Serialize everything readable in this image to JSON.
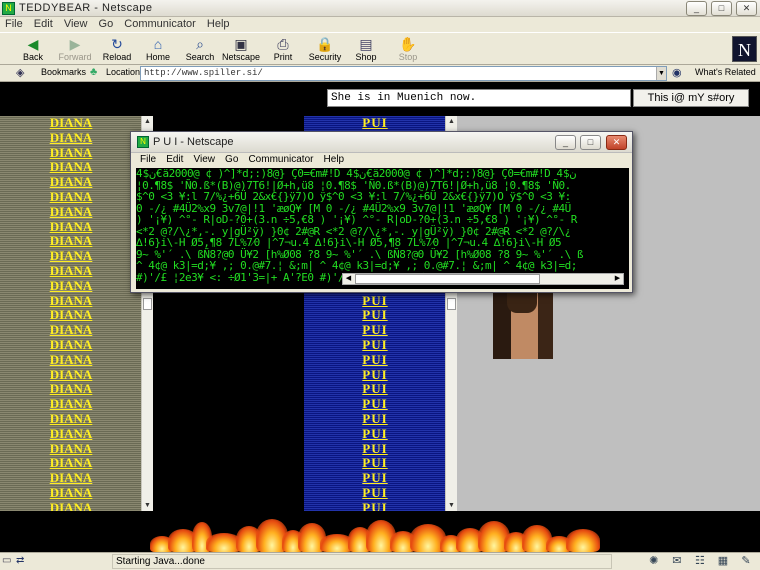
{
  "window": {
    "title": "TEDDYBEAR - Netscape",
    "min_label": "_",
    "max_label": "□",
    "close_label": "✕"
  },
  "menu": [
    "File",
    "Edit",
    "View",
    "Go",
    "Communicator",
    "Help"
  ],
  "toolbar": {
    "buttons": [
      {
        "label": "Back",
        "icon": "back-arrow-icon",
        "glyph": "◀"
      },
      {
        "label": "Forward",
        "icon": "forward-arrow-icon",
        "glyph": "▶"
      },
      {
        "label": "Reload",
        "icon": "reload-icon",
        "glyph": "↻"
      },
      {
        "label": "Home",
        "icon": "home-icon",
        "glyph": "⌂"
      },
      {
        "label": "Search",
        "icon": "search-icon",
        "glyph": "⌕"
      },
      {
        "label": "Netscape",
        "icon": "netscape-icon",
        "glyph": "▣"
      },
      {
        "label": "Print",
        "icon": "print-icon",
        "glyph": "⎙"
      },
      {
        "label": "Security",
        "icon": "lock-icon",
        "glyph": "🔒"
      },
      {
        "label": "Shop",
        "icon": "shop-icon",
        "glyph": "▤"
      },
      {
        "label": "Stop",
        "icon": "stop-icon",
        "glyph": "✋"
      }
    ],
    "logo": "N"
  },
  "location": {
    "bookmarks_label": "Bookmarks",
    "location_label": "Location:",
    "url": "http://www.spiller.si/",
    "whats_related_label": "What's Related"
  },
  "page": {
    "message_value": "She is in Muenich now.",
    "story_button": "This i@ mY s#ory",
    "left_frame_word": "DIANA",
    "left_frame_repeat": 27,
    "mid_frame_word": "PUI",
    "mid_frame_repeat": 27
  },
  "popup": {
    "title": "P U I - Netscape",
    "menu": [
      "File",
      "Edit",
      "View",
      "Go",
      "Communicator",
      "Help"
    ],
    "matrix_lines": [
      "ن$4€ä2000@ ¢ )^]*d;:)8@} Ç0=€m#!D ن$4€ä2000@ ¢ )^]*d;:)8@} Ç0=€m#!D ن$4",
      "¦0.¶8$ 'Ñ0.ß*(B)@)7T6!|Ø+h,ü8 ¦0.¶8$ 'Ñ0.ß*(B)@)7T6!|Ø+h,ü8 ¦0.¶8$ 'Ñ0.",
      "$^0 <3 ¥:l 7/%¿+6Ü 2&x€{}ÿ7)O ÿ$^0 <3 ¥:l 7/%¿+6Ü 2&x€{}ÿ7)O ÿ$^0 <3 ¥:",
      "0 -/¿ #4Ü2%x9 3v7@|!1 'æøQ¥ [M 0 -/¿ #4Ü2%x9 3v7@|!1 'æøQ¥ [M 0 -/¿ #4Ü",
      ") '¡¥) ^°- R|oD-?0+(3.n ÷5,€8 ) '¡¥) ^°- R|oD-?0+(3.n ÷5,€8 ) '¡¥) ^°- R",
      "<*2 @?/\\¿*,-. y|gÜ²ÿ) }0¢ 2#@R <*2 @?/\\¿*,-. y|gÜ²ÿ) }0¢ 2#@R <*2 @?/\\¿",
      "∆!6}i\\-H Ø5,¶8 7L%7⁄0 |^7¬u.4 ∆!6}i\\-H Ø5,¶8 7L%7⁄0 |^7¬u.4 ∆!6}i\\-H Ø5",
      "9~ %'´ .\\ ßÑ8?@0 Ü¥2 [h%Ø08 ?8 9~ %'´ .\\ ßÑ8?@0 Ü¥2 [h%Ø08 ?8 9~ %'´ .\\ ß",
      "^ 4¢@ k3|=d;¥ ,; 0.@#7.¦ &;m| ^ 4¢@ k3|=d;¥ ,; 0.@#7.¦ &;m| ^ 4¢@ k3|=d;",
      "#)'/£ ¦2e3¥ <: ÷Ø1'3=|+ A'?E0 #)'/£ ¦2e3¥ <: ÷Ø1'3=|+ A'?E0 #)'/£ ¦2e3¥"
    ]
  },
  "status": {
    "text": "Starting Java...done"
  }
}
